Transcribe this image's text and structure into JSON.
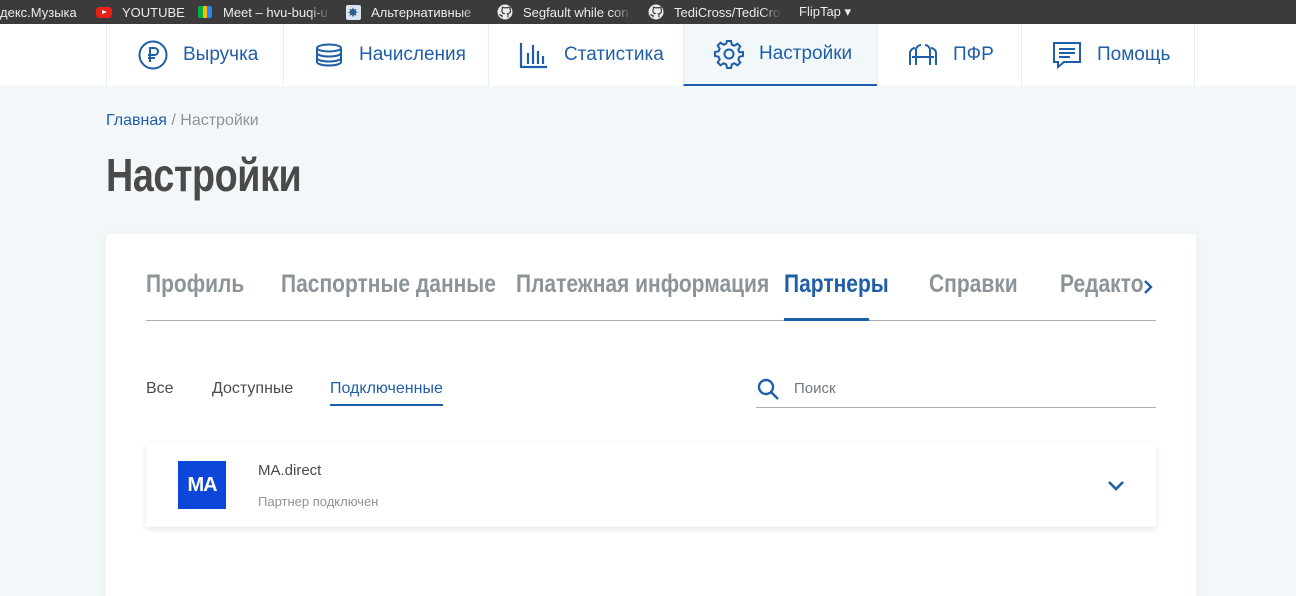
{
  "bookmarks": [
    {
      "label": "декс.Музыка",
      "icon": "none"
    },
    {
      "label": "YOUTUBE",
      "icon": "youtube-icon"
    },
    {
      "label": "Meet – hvu-buqi-u",
      "icon": "google-meet-icon"
    },
    {
      "label": "Альтернативные",
      "icon": "bookmark-site-icon"
    },
    {
      "label": "Segfault while con",
      "icon": "github-icon"
    },
    {
      "label": "TediCross/TediCro",
      "icon": "github-icon"
    },
    {
      "label": "FlipTap ▾",
      "icon": "none"
    }
  ],
  "nav": {
    "items": [
      {
        "label": "Выручка",
        "icon": "ruble-icon",
        "active": false
      },
      {
        "label": "Начисления",
        "icon": "coins-icon",
        "active": false
      },
      {
        "label": "Статистика",
        "icon": "bar-chart-icon",
        "active": false
      },
      {
        "label": "Настройки",
        "icon": "gear-icon",
        "active": true
      },
      {
        "label": "ПФР",
        "icon": "pfr-logo-icon",
        "active": false
      },
      {
        "label": "Помощь",
        "icon": "chat-icon",
        "active": false
      }
    ]
  },
  "breadcrumb": {
    "home": "Главная",
    "separator": "/",
    "current": "Настройки"
  },
  "page": {
    "title": "Настройки"
  },
  "tabs": {
    "items": [
      {
        "label": "Профиль",
        "active": false
      },
      {
        "label": "Паспортные данные",
        "active": false
      },
      {
        "label": "Платежная информация",
        "active": false
      },
      {
        "label": "Партнеры",
        "active": true
      },
      {
        "label": "Справки",
        "active": false
      },
      {
        "label": "Редакто",
        "active": false
      }
    ],
    "next_icon": "chevron-right-icon"
  },
  "filters": {
    "items": [
      {
        "label": "Все",
        "active": false
      },
      {
        "label": "Доступные",
        "active": false
      },
      {
        "label": "Подключенные",
        "active": true
      }
    ]
  },
  "search": {
    "placeholder": "Поиск",
    "value": "",
    "icon": "search-icon"
  },
  "partners": [
    {
      "logo_text": "MA",
      "name": "MA.direct",
      "status": "Партнер подключен",
      "expand_icon": "chevron-down-icon"
    }
  ],
  "colors": {
    "accent": "#1f5ea8",
    "background": "#f2f7fa",
    "text": "#4a4a4a",
    "muted": "#8c9399",
    "logo": "#0d47d9"
  }
}
